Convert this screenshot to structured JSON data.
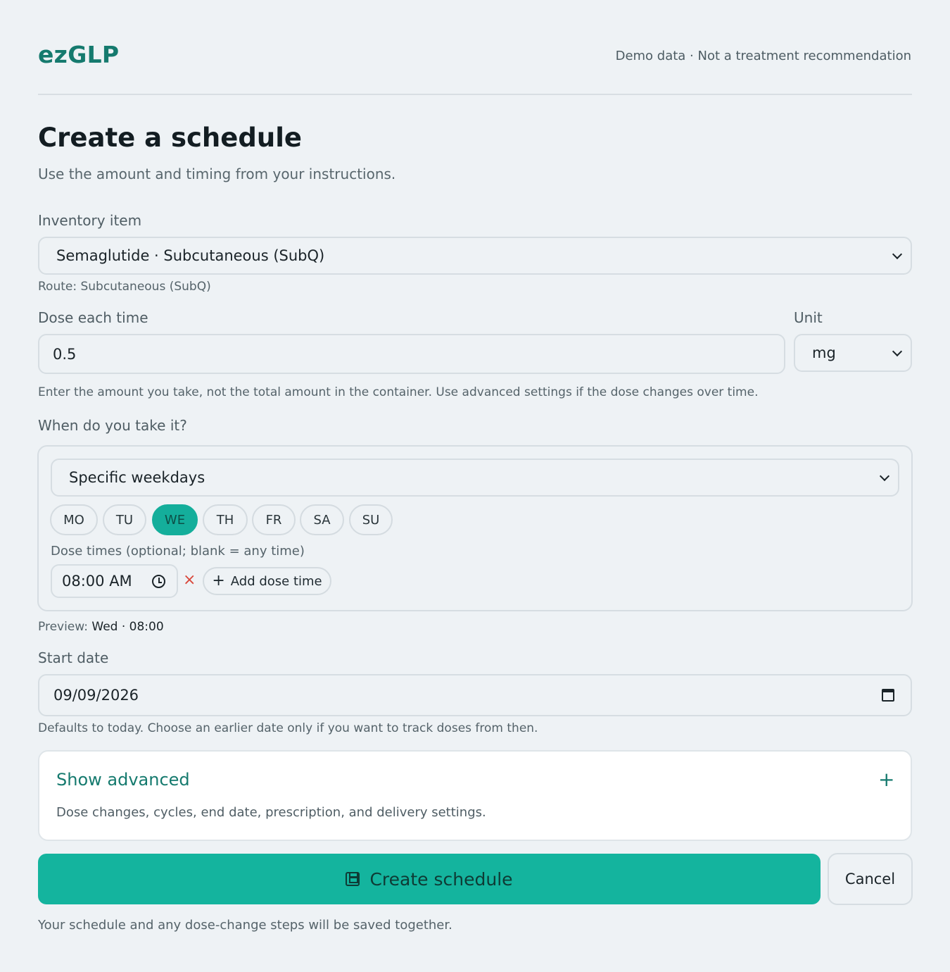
{
  "header": {
    "brand": "ezGLP",
    "note": "Demo data · Not a treatment recommendation"
  },
  "page": {
    "title": "Create a schedule",
    "subtitle": "Use the amount and timing from your instructions."
  },
  "inventory": {
    "label": "Inventory item",
    "selected": "Semaglutide · Subcutaneous (SubQ)",
    "route_note": "Route: Subcutaneous (SubQ)"
  },
  "dose": {
    "label": "Dose each time",
    "value": "0.5",
    "unit_label": "Unit",
    "unit_value": "mg",
    "hint": "Enter the amount you take, not the total amount in the container. Use advanced settings if the dose changes over time."
  },
  "when": {
    "label": "When do you take it?",
    "frequency": "Specific weekdays",
    "days": [
      {
        "label": "MO",
        "selected": false
      },
      {
        "label": "TU",
        "selected": false
      },
      {
        "label": "WE",
        "selected": true
      },
      {
        "label": "TH",
        "selected": false
      },
      {
        "label": "FR",
        "selected": false
      },
      {
        "label": "SA",
        "selected": false
      },
      {
        "label": "SU",
        "selected": false
      }
    ],
    "times_label": "Dose times (optional; blank = any time)",
    "time_value": "08:00 AM",
    "remove_icon": "×",
    "add_time_icon": "+",
    "add_time_label": "Add dose time"
  },
  "preview": {
    "label": "Preview:",
    "value": "Wed · 08:00"
  },
  "start": {
    "label": "Start date",
    "value": "09/09/2026",
    "hint": "Defaults to today. Choose an earlier date only if you want to track doses from then."
  },
  "advanced": {
    "title": "Show advanced",
    "toggle_icon": "+",
    "description": "Dose changes, cycles, end date, prescription, and delivery settings."
  },
  "actions": {
    "create_label": "Create schedule",
    "cancel_label": "Cancel",
    "footer_note": "Your schedule and any dose-change steps will be saved together."
  },
  "colors": {
    "background": "#eef2f5",
    "brand": "#157a6e",
    "accent": "#14b49e",
    "danger": "#d9483b"
  }
}
